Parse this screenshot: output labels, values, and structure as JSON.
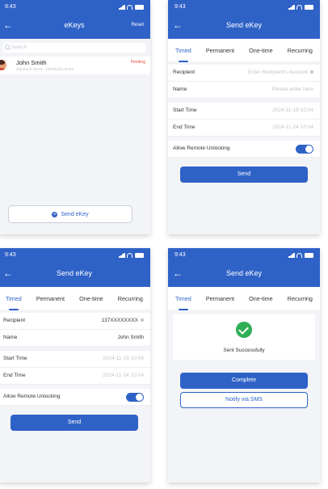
{
  "status_time": "9:43",
  "screen1": {
    "title": "eKeys",
    "reset_label": "Reset",
    "search_placeholder": "Search",
    "user": {
      "name": "John Smith",
      "date": "2024/11/2 10:04 - 2024/11/21 10:04",
      "status": "Pending"
    },
    "send_ekey_label": "Send eKey"
  },
  "send_title": "Send eKey",
  "tabs": [
    "Timed",
    "Permanent",
    "One-time",
    "Recurring"
  ],
  "screen2": {
    "recipient_label": "Recipient",
    "recipient_placeholder": "Enter Recipient's Account",
    "name_label": "Name",
    "name_placeholder": "Please enter here",
    "start_label": "Start Time",
    "start_value": "2024-11-19 10:04",
    "end_label": "End Time",
    "end_value": "2024-11-24 10:04",
    "remote_label": "Allow Remote Unlocking",
    "send_label": "Send"
  },
  "screen3": {
    "recipient_label": "Recipient",
    "recipient_value": "137XXXXXXXX",
    "name_label": "Name",
    "name_value": "John Smith",
    "start_label": "Start Time",
    "start_value": "2024-11-19 10:04",
    "end_label": "End Time",
    "end_value": "2024-11-24 10:04",
    "remote_label": "Allow Remote Unlocking",
    "send_label": "Send"
  },
  "screen4": {
    "success_text": "Sent Successfully",
    "complete_label": "Complete",
    "sms_label": "Notify via SMS"
  },
  "colors": {
    "primary": "#2f62c7",
    "success": "#2eae57",
    "pending": "#e74c3c",
    "background": "#f2f4f7"
  }
}
